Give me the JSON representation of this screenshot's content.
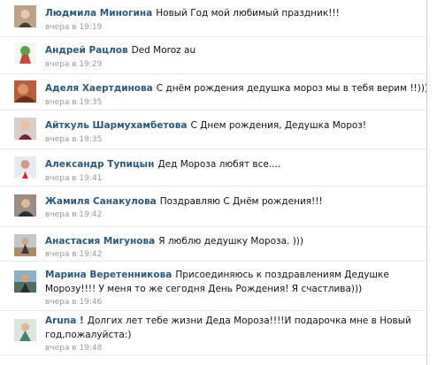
{
  "comments": [
    {
      "author": "Людмила Миногина",
      "text": "Новый Год мой любимый праздник!!!",
      "time": "вчера в 19:19",
      "avatar": "woman-avatar"
    },
    {
      "author": "Андрей Рацлов",
      "text": "Ded Moroz au",
      "time": "вчера в 19:29",
      "avatar": "cartoon-avatar"
    },
    {
      "author": "Аделя Хаертдинова",
      "text": "С днём рождения дедушка мороз мы в тебя верим !!)))",
      "time": "вчера в 19:35",
      "avatar": "autumn-avatar"
    },
    {
      "author": "Айткуль Шармухамбетова",
      "text": "С Днем рождения, Дедушка Мороз!",
      "time": "вчера в 19:35",
      "avatar": "woman-avatar"
    },
    {
      "author": "Александр Тупицын",
      "text": "Дед Мороза любят все....",
      "time": "вчера в 19:41",
      "avatar": "man-avatar"
    },
    {
      "author": "Жамиля Санакулова",
      "text": "Поздравляю С Днём рождения!!!",
      "time": "вчера в 19:42",
      "avatar": "woman-avatar"
    },
    {
      "author": "Анастасия Мигунова",
      "text": "Я люблю дедушку Мороза. )))",
      "time": "вчера в 19:42",
      "avatar": "outdoor-avatar"
    },
    {
      "author": "Марина Веретенникова",
      "text": "Присоединяюсь к поздравлениям Дедушке Морозу!!!! У меня то же сегодня День Рождения! Я счастлива)))",
      "time": "вчера в 19:46",
      "avatar": "outdoor-avatar"
    },
    {
      "author": "Aruna !",
      "text": "Долгих лет тебе жизни Деда Мороза!!!!И подарочка мне в Новый год,пожалуйста:)",
      "time": "вчера в 19:48",
      "avatar": "woman-avatar"
    }
  ]
}
